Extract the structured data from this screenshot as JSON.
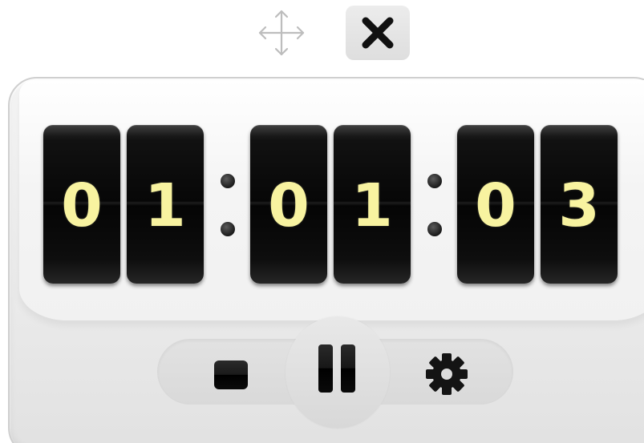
{
  "window": {
    "move_icon": "move-arrows-icon",
    "close_icon": "close-x-icon"
  },
  "timer": {
    "hours": [
      "0",
      "1"
    ],
    "minutes": [
      "0",
      "1"
    ],
    "seconds": [
      "0",
      "3"
    ],
    "digit_color": "#f8f3a0"
  },
  "controls": {
    "stop_icon": "stop-icon",
    "pause_icon": "pause-icon",
    "settings_icon": "gear-icon"
  }
}
